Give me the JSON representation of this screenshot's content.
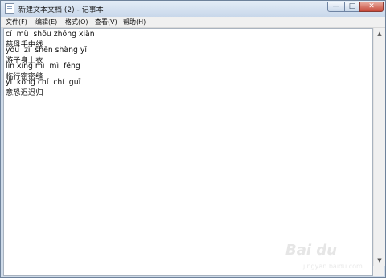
{
  "window": {
    "title": "新建文本文档 (2) - 记事本",
    "controls": {
      "minimize": "—",
      "maximize": "□",
      "close": "✕"
    }
  },
  "menu": [
    "文件(F)",
    "编辑(E)",
    "格式(O)",
    "查看(V)",
    "帮助(H)"
  ],
  "document": {
    "lines": [
      "cí  mǔ  shǒu zhōng xiàn",
      "慈母手中线",
      "yóu  zǐ  shēn shàng yī",
      "游子身上衣",
      "lín xíng mì  mì  féng",
      "临行密密缝",
      "yì  kǒng chí  chí  guī",
      "意恐迟迟归"
    ]
  },
  "watermark": {
    "text": "Bai du",
    "sub": "jingyan.baidu.com"
  },
  "colors": {
    "titlebar": "#c8d7ea",
    "close_button": "#c7493a",
    "editor_bg": "#ffffff"
  }
}
